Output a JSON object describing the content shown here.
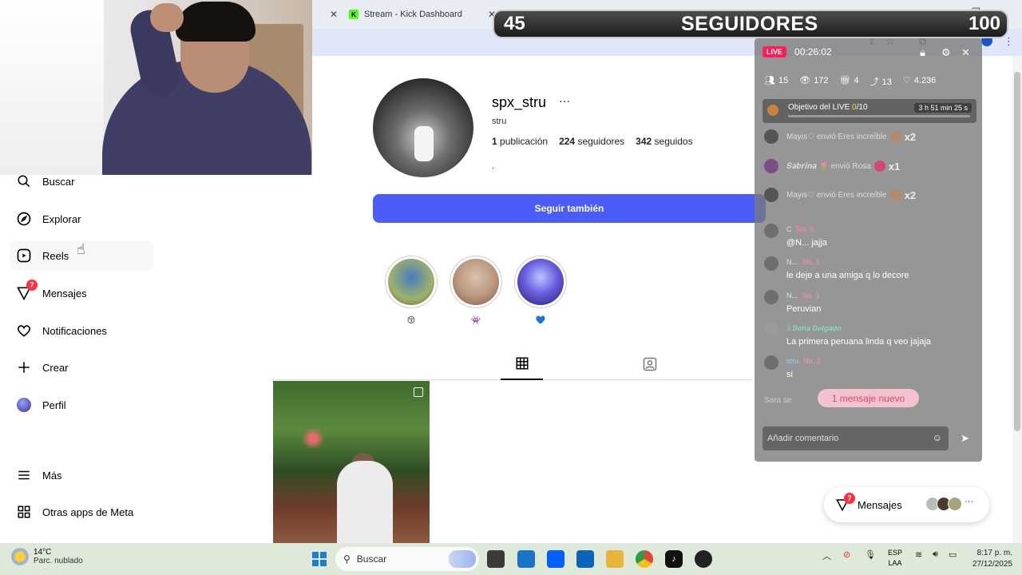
{
  "browser": {
    "tab_close_glyph": "✕",
    "tab_kick_title": "Stream - Kick Dashboard",
    "kick_favicon_letter": "K",
    "window_controls": [
      "—",
      "❐",
      "✕"
    ]
  },
  "banner": {
    "count": "45",
    "label": "SEGUIDORES",
    "goal": "100"
  },
  "sidebar": {
    "items": [
      {
        "label": "Buscar",
        "icon": "search-icon"
      },
      {
        "label": "Explorar",
        "icon": "compass-icon"
      },
      {
        "label": "Reels",
        "icon": "reels-icon"
      },
      {
        "label": "Mensajes",
        "icon": "messenger-icon",
        "badge": "7"
      },
      {
        "label": "Notificaciones",
        "icon": "heart-icon"
      },
      {
        "label": "Crear",
        "icon": "plus-icon"
      },
      {
        "label": "Perfil",
        "icon": "avatar"
      },
      {
        "label": "Más",
        "icon": "menu-icon"
      },
      {
        "label": "Otras apps de Meta",
        "icon": "apps-icon"
      }
    ]
  },
  "profile": {
    "username": "spx_stru",
    "more": "···",
    "full_name": "stru",
    "posts_count": "1",
    "posts_label": "publicación",
    "followers_count": "224",
    "followers_label": "seguidores",
    "following_count": "342",
    "following_label": "seguidos",
    "bio": ".",
    "follow_button": "Seguir también",
    "highlights": [
      {
        "caption": "😚",
        "color": "#9db36a"
      },
      {
        "caption": "👾",
        "color": "#b9957c"
      },
      {
        "caption": "💙",
        "color": "#3f3cb0"
      }
    ]
  },
  "live": {
    "pill": "LIVE",
    "time": "00:26:02",
    "stats": [
      {
        "icon": "people-icon",
        "value": "15"
      },
      {
        "icon": "eye-icon",
        "value": "172"
      },
      {
        "icon": "gift-icon",
        "value": "4"
      },
      {
        "icon": "share-icon",
        "value": "13"
      },
      {
        "icon": "heart-icon",
        "value": "4.236"
      }
    ],
    "goal_title": "Objetivo del LIVE",
    "goal_progress": "0",
    "goal_total": "/10",
    "goal_timer": "3 h 51 min 25 s",
    "gifts": [
      {
        "name": "Mayis♡",
        "text": "envió Eres increíble",
        "mult": "x2"
      },
      {
        "name": "𝑺𝒂𝒃𝒓𝒊𝒏𝒂 🌷",
        "text": "envió Rosa",
        "mult": "x1"
      },
      {
        "name": "Mayis♡",
        "text": "envió Eres increíble",
        "mult": "x2"
      }
    ],
    "comments": [
      {
        "meta": "C",
        "rank": "No. 3",
        "body": "@N... jajja"
      },
      {
        "meta": "N...",
        "rank": "No. 1",
        "body": "le deje a una amiga q lo decore"
      },
      {
        "meta": "N...",
        "rank": "No. 1",
        "body": "Peruvian"
      },
      {
        "meta": "3 𝑺𝒐𝒇𝒊𝒂 𝑫𝒆𝒍𝒈𝒂𝒅𝒐",
        "rank": "",
        "body": "La primera peruana linda q veo jajaja"
      },
      {
        "meta": "stru",
        "rank": "No. 2",
        "body": "si"
      }
    ],
    "ghost_text": "Sara se",
    "new_messages": "1 mensaje nuevo",
    "comment_placeholder": "Añadir comentario"
  },
  "messages_float": {
    "label": "Mensajes",
    "badge": "7"
  },
  "taskbar": {
    "temp": "14°C",
    "weather": "Parc. nublado",
    "search_label": "Buscar",
    "lang_top": "ESP",
    "lang_bottom": "LAA",
    "time": "8:17 p. m.",
    "date": "27/12/2025",
    "apps": [
      {
        "name": "file-explorer-icon",
        "color": "#3a3a3a"
      },
      {
        "name": "store-icon",
        "color": "#1a73c4"
      },
      {
        "name": "dropbox-icon",
        "color": "#0061fe"
      },
      {
        "name": "outlook-icon",
        "color": "#0a64b8"
      },
      {
        "name": "folder-icon",
        "color": "#e8b43a"
      },
      {
        "name": "chrome-icon",
        "color": "#e04536"
      },
      {
        "name": "tiktok-icon",
        "color": "#111111"
      },
      {
        "name": "app-icon",
        "color": "#222222"
      }
    ]
  }
}
